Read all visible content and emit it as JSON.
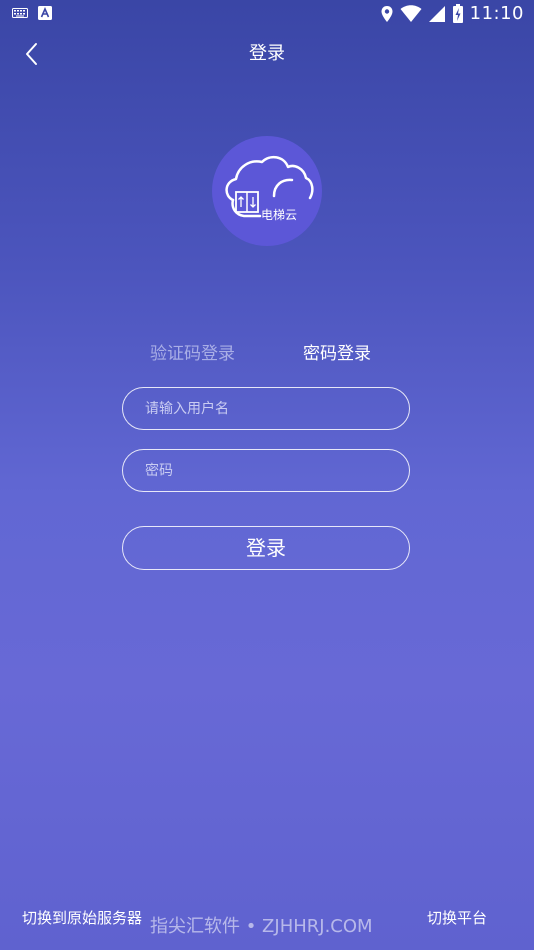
{
  "status_bar": {
    "time": "11:10",
    "left_icons": [
      "keyboard-icon",
      "a-notification-icon"
    ],
    "right_icons": [
      "location-icon",
      "wifi-icon",
      "signal-icon",
      "battery-charging-icon"
    ]
  },
  "header": {
    "title": "登录",
    "back_icon": "chevron-left-icon"
  },
  "logo": {
    "text": "电梯云",
    "icons": [
      "cloud-icon",
      "elevator-icon"
    ],
    "circle_color": "#5c57d7"
  },
  "tabs": [
    {
      "label": "验证码登录",
      "active": false
    },
    {
      "label": "密码登录",
      "active": true
    }
  ],
  "form": {
    "username_placeholder": "请输入用户名",
    "username_value": "",
    "password_placeholder": "密码",
    "password_value": "",
    "submit_label": "登录"
  },
  "footer": {
    "switch_server_label": "切换到原始服务器",
    "switch_platform_label": "切换平台",
    "watermark": "指尖汇软件 • ZJHHRJ.COM"
  },
  "colors": {
    "background_top": "#3a46a6",
    "background_mid": "#6167d3",
    "inactive_tab": "#a9aee6",
    "text": "#ffffff"
  }
}
